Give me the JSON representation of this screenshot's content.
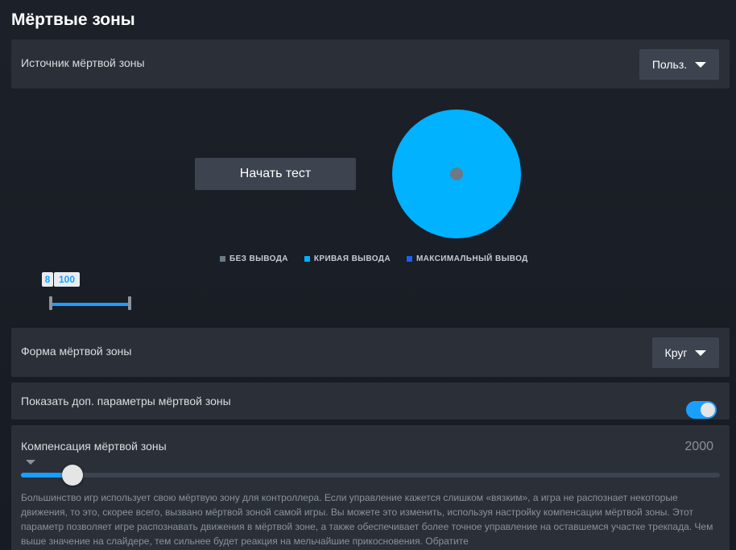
{
  "page_title": "Мёртвые зоны",
  "source_row": {
    "label": "Источник мёртвой зоны",
    "dropdown_value": "Польз."
  },
  "test_button": {
    "label": "Начать тест"
  },
  "legend": [
    {
      "label": "БЕЗ ВЫВОДА",
      "color": "#6b7a86"
    },
    {
      "label": "КРИВАЯ ВЫВОДА",
      "color": "#00b2ff"
    },
    {
      "label": "МАКСИМАЛЬНЫЙ ВЫВОД",
      "color": "#1a5fff"
    }
  ],
  "range": {
    "min_label": "8",
    "max_label": "100"
  },
  "shape_row": {
    "label": "Форма мёртвой зоны",
    "dropdown_value": "Круг"
  },
  "advanced_row": {
    "label": "Показать доп. параметры мёртвой зоны",
    "toggle_on": true
  },
  "compensation": {
    "label": "Компенсация мёртвой зоны",
    "value": "2000",
    "slider_fraction": 0.074,
    "description": "Большинство игр использует свою мёртвую зону для контроллера. Если управление кажется слишком «вязким», а игра не распознает некоторые движения, то это, скорее всего, вызвано мёртвой зоной самой игры. Вы можете это изменить, используя настройку компенсации мёртвой зоны. Этот параметр позволяет игре распознавать движения в мёртвой зоне, а также обеспечивает более точное управление на оставшемся участке трекпада. Чем выше значение на слайдере, тем сильнее будет реакция на мельчайшие прикосновения. Обратите"
  },
  "colors": {
    "accent": "#1a9fff",
    "circle": "#00b2ff",
    "panel": "#2a2f38"
  }
}
